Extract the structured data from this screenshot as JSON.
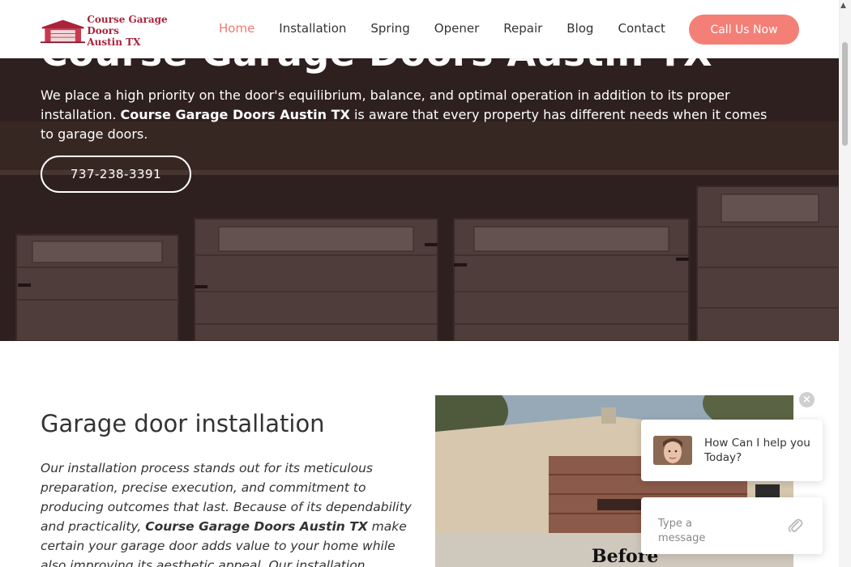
{
  "header": {
    "logo_text": "Course Garage Doors\nAustin TX",
    "nav": [
      {
        "label": "Home",
        "active": true
      },
      {
        "label": "Installation",
        "active": false
      },
      {
        "label": "Spring",
        "active": false
      },
      {
        "label": "Opener",
        "active": false
      },
      {
        "label": "Repair",
        "active": false
      },
      {
        "label": "Blog",
        "active": false
      },
      {
        "label": "Contact",
        "active": false
      }
    ],
    "call_label": "Call Us Now"
  },
  "hero": {
    "title": "Course Garage Doors Austin TX",
    "text_part1": "We place a high priority on the door's equilibrium, balance, and optimal operation in addition to its proper installation. ",
    "text_bold": "Course Garage Doors Austin TX",
    "text_part2": " is aware that every property has different needs when it comes to garage doors.",
    "phone": "737-238-3391"
  },
  "installation": {
    "title": "Garage door installation",
    "text_part1": "Our installation process stands out for its meticulous preparation, precise execution, and commitment to producing outcomes that last. Because of its dependability and practicality, ",
    "text_bold": "Course Garage Doors Austin TX",
    "text_part2": " make certain your garage door adds value to your home while also improving its aesthetic appeal. Our installation experts limit disruptions to your daily",
    "photo_label": "Before"
  },
  "chat": {
    "close_symbol": "×",
    "message": "How Can I help you Today?",
    "input_placeholder": "Type a message"
  },
  "colors": {
    "accent": "#f47f77",
    "active_nav": "#f07a72",
    "logo_red": "#a9233b"
  }
}
